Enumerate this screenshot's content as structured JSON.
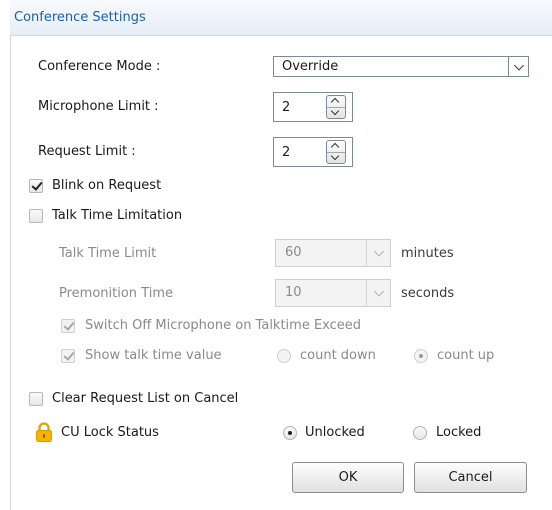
{
  "header": {
    "title": "Conference Settings"
  },
  "conference_mode": {
    "label": "Conference Mode :",
    "value": "Override"
  },
  "microphone_limit": {
    "label": "Microphone Limit :",
    "value": "2"
  },
  "request_limit": {
    "label": "Request Limit :",
    "value": "2"
  },
  "blink_on_request": {
    "label": "Blink on Request",
    "checked": true
  },
  "talk_time_limitation": {
    "label": "Talk Time Limitation",
    "checked": false
  },
  "talk_time_limit": {
    "label": "Talk Time Limit",
    "value": "60",
    "unit": "minutes"
  },
  "premonition_time": {
    "label": "Premonition Time",
    "value": "10",
    "unit": "seconds"
  },
  "switch_off_mic": {
    "label": "Switch Off Microphone on Talktime Exceed",
    "checked": true,
    "enabled": false
  },
  "show_talk_time": {
    "label": "Show talk time value",
    "checked": true,
    "enabled": false,
    "options": [
      "count down",
      "count up"
    ],
    "selected": "count up"
  },
  "clear_request_list": {
    "label": "Clear Request List on Cancel",
    "checked": false
  },
  "cu_lock": {
    "label": "CU Lock Status",
    "icon": "lock-icon",
    "icon_color": "#f5b400",
    "options": [
      "Unlocked",
      "Locked"
    ],
    "selected": "Unlocked"
  },
  "buttons": {
    "ok": "OK",
    "cancel": "Cancel"
  },
  "colors": {
    "header_text": "#1c5fae",
    "header_bg": "#e6eef7",
    "disabled_text": "#8a8a8a"
  }
}
